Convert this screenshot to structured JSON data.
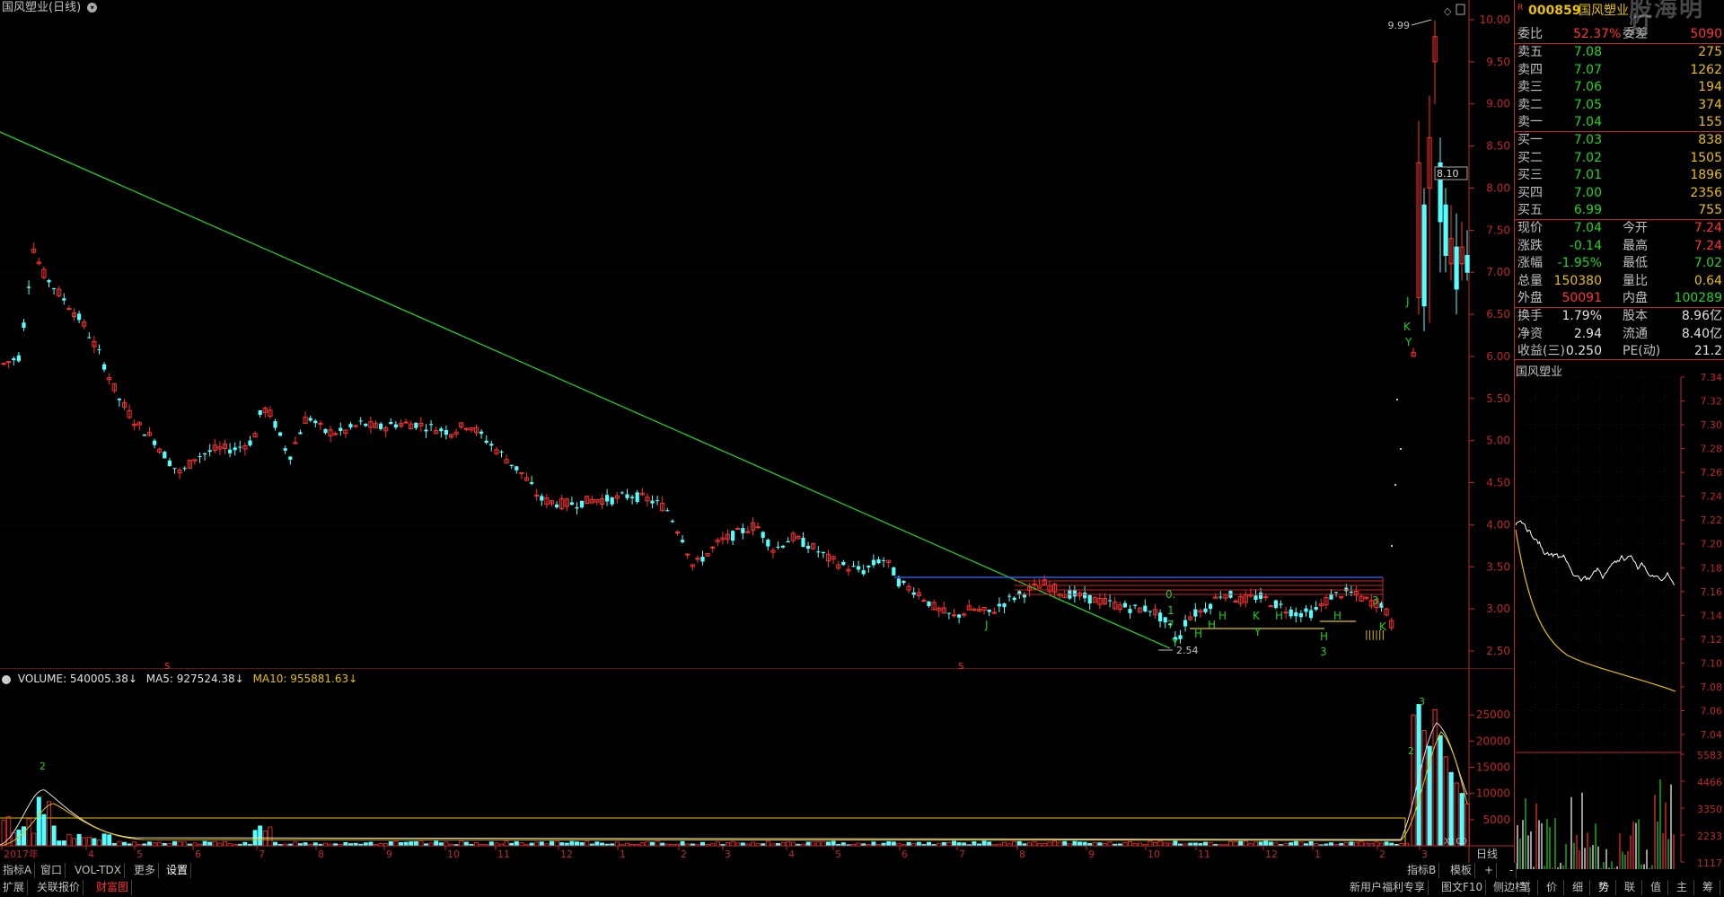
{
  "title": "国风塑业(日线)",
  "quote": {
    "code": "000859",
    "name": "国风塑业",
    "weibi_label": "委比",
    "weibi": "52.37%",
    "weicha_label": "委差",
    "weicha": "5090",
    "asks": [
      {
        "label": "卖五",
        "price": "7.08",
        "vol": "275"
      },
      {
        "label": "卖四",
        "price": "7.07",
        "vol": "1262"
      },
      {
        "label": "卖三",
        "price": "7.06",
        "vol": "194"
      },
      {
        "label": "卖二",
        "price": "7.05",
        "vol": "374"
      },
      {
        "label": "卖一",
        "price": "7.04",
        "vol": "155"
      }
    ],
    "bids": [
      {
        "label": "买一",
        "price": "7.03",
        "vol": "838"
      },
      {
        "label": "买二",
        "price": "7.02",
        "vol": "1505"
      },
      {
        "label": "买三",
        "price": "7.01",
        "vol": "1896"
      },
      {
        "label": "买四",
        "price": "7.00",
        "vol": "2356"
      },
      {
        "label": "买五",
        "price": "6.99",
        "vol": "755"
      }
    ],
    "stats1": [
      {
        "l1": "现价",
        "v1": "7.04",
        "l2": "今开",
        "v2": "7.24",
        "c1": "#22d422",
        "c2": "#ff3333"
      },
      {
        "l1": "涨跌",
        "v1": "-0.14",
        "l2": "最高",
        "v2": "7.24",
        "c1": "#22d422",
        "c2": "#ff3333"
      },
      {
        "l1": "涨幅",
        "v1": "-1.95%",
        "l2": "最低",
        "v2": "7.02",
        "c1": "#22d422",
        "c2": "#22d422"
      },
      {
        "l1": "总量",
        "v1": "150380",
        "l2": "量比",
        "v2": "0.64",
        "c1": "#e8c000",
        "c2": "#e8c000"
      },
      {
        "l1": "外盘",
        "v1": "50091",
        "l2": "内盘",
        "v2": "100289",
        "c1": "#ff3333",
        "c2": "#22d422"
      }
    ],
    "stats2": [
      {
        "l1": "换手",
        "v1": "1.79%",
        "l2": "股本",
        "v2": "8.96亿"
      },
      {
        "l1": "净资",
        "v1": "2.94",
        "l2": "流通",
        "v2": "8.40亿"
      },
      {
        "l1": "收益(三)",
        "v1": "0.250",
        "l2": "PE(动)",
        "v2": "21.2"
      }
    ],
    "watermark": "股海明灯"
  },
  "intraday_title": "国风塑业",
  "volume_legend": {
    "vol": "VOLUME: 540005.38↓",
    "ma5": "MA5: 927524.38↓",
    "ma10": "MA10: 955881.63↓"
  },
  "chart_data": {
    "type": "candlestick",
    "price_axis": {
      "ticks": [
        2.5,
        3.0,
        3.5,
        4.0,
        4.5,
        5.0,
        5.5,
        6.0,
        6.5,
        7.0,
        7.5,
        8.0,
        8.5,
        9.0,
        9.5,
        10.0
      ],
      "range": [
        2.2,
        10.2
      ]
    },
    "volume_axis": {
      "ticks": [
        5000,
        10000,
        15000,
        20000,
        25000
      ],
      "range": [
        0,
        30000
      ],
      "multiplier_label": "X100"
    },
    "time_labels": [
      "2017年",
      "4",
      "5",
      "6",
      "7",
      "8",
      "9",
      "10",
      "11",
      "12",
      "1",
      "2",
      "3",
      "4",
      "5",
      "6",
      "7",
      "8",
      "9",
      "10",
      "11",
      "12",
      "1",
      "2",
      "3"
    ],
    "annotations": {
      "high_label": "9.99",
      "low_label": "2.54",
      "ref_label": "8.10"
    },
    "intraday": {
      "ticks": [
        "7.34",
        "7.32",
        "7.30",
        "7.28",
        "7.26",
        "7.24",
        "7.22",
        "7.20",
        "7.18",
        "7.16",
        "7.14",
        "7.12",
        "7.10",
        "7.08",
        "7.06",
        "7.04"
      ],
      "vol_ticks": [
        "5583",
        "4466",
        "3350",
        "2233",
        "1117"
      ]
    }
  },
  "bottom": {
    "row1": [
      "指标A",
      "窗口",
      "VOL-TDX",
      "更多",
      "设置"
    ],
    "row2": [
      "扩展",
      "关联报价",
      "财富图"
    ],
    "right_row1": [
      "指标B",
      "模板",
      "+",
      "-"
    ],
    "right_row2": [
      "新用户福利专享",
      "图文F10",
      "侧边栏"
    ],
    "period_label": "日线",
    "side_tabs": [
      "笔",
      "价",
      "细",
      "势",
      "联",
      "值",
      "主",
      "筹"
    ]
  }
}
